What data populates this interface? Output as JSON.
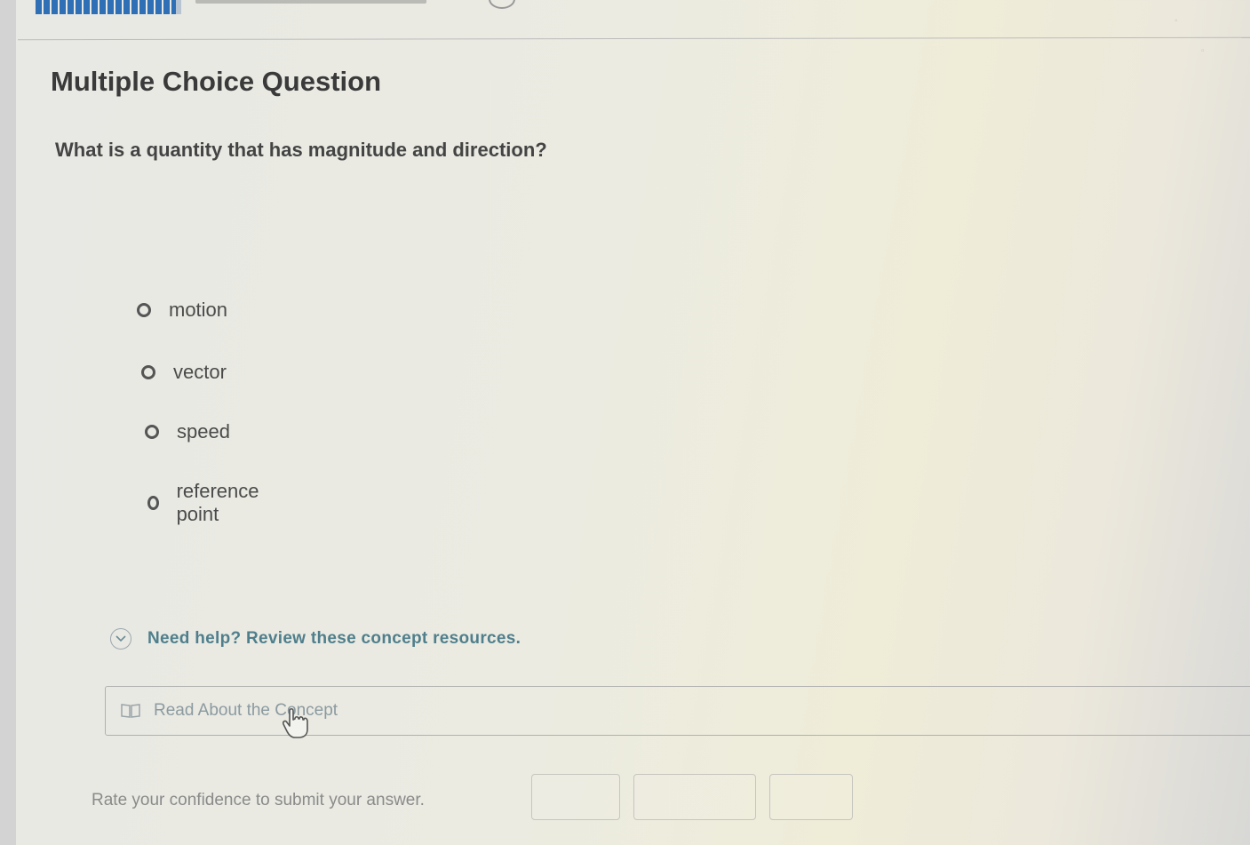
{
  "header": {
    "progress": 0.95
  },
  "question": {
    "type_label": "Multiple Choice Question",
    "prompt": "What is a quantity that has magnitude and direction?",
    "options": [
      {
        "label": "motion"
      },
      {
        "label": "vector"
      },
      {
        "label": "speed"
      },
      {
        "label": "reference point"
      }
    ]
  },
  "help": {
    "toggle_label": "Need help? Review these concept resources.",
    "resource_label": "Read About the Concept"
  },
  "confidence": {
    "prompt": "Rate your confidence to submit your answer."
  },
  "icons": {
    "help_toggle": "chevron-down-circle-icon",
    "resource": "book-icon",
    "cursor": "hand-pointer-icon"
  }
}
